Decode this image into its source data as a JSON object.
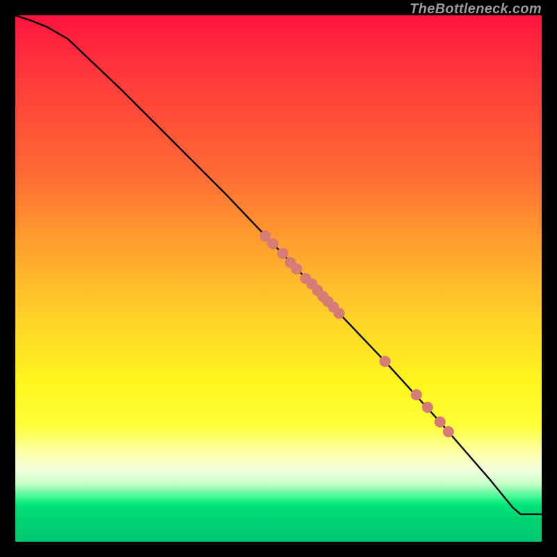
{
  "watermark": "TheBottleneck.com",
  "chart_data": {
    "type": "line",
    "title": "",
    "xlabel": "",
    "ylabel": "",
    "xlim": [
      0,
      100
    ],
    "ylim": [
      0,
      100
    ],
    "grid": false,
    "legend": false,
    "gradient_colors": {
      "top": "#ff143f",
      "mid_upper": "#ff9a2e",
      "mid": "#fff61e",
      "pale": "#fbffb0",
      "green": "#00d173"
    },
    "curve": {
      "x": [
        0,
        3,
        6,
        10,
        20,
        30,
        40,
        50,
        60,
        70,
        80,
        90,
        94.5,
        96,
        100
      ],
      "y": [
        100,
        99,
        97.8,
        95.5,
        86,
        76,
        66,
        55.5,
        45,
        34.5,
        23.5,
        12,
        6.5,
        5.2,
        5.2
      ]
    },
    "points": [
      {
        "x": 47.5,
        "y": 58.1
      },
      {
        "x": 48.9,
        "y": 56.6
      },
      {
        "x": 50.8,
        "y": 54.7
      },
      {
        "x": 52.3,
        "y": 53.1
      },
      {
        "x": 53.4,
        "y": 51.9
      },
      {
        "x": 55.2,
        "y": 50.0
      },
      {
        "x": 56.3,
        "y": 48.9
      },
      {
        "x": 57.4,
        "y": 47.7
      },
      {
        "x": 58.5,
        "y": 46.6
      },
      {
        "x": 59.4,
        "y": 45.6
      },
      {
        "x": 60.4,
        "y": 44.6
      },
      {
        "x": 61.5,
        "y": 43.4
      },
      {
        "x": 70.2,
        "y": 34.3
      },
      {
        "x": 76.2,
        "y": 27.9
      },
      {
        "x": 78.3,
        "y": 25.5
      },
      {
        "x": 80.7,
        "y": 22.8
      },
      {
        "x": 82.3,
        "y": 20.9
      }
    ]
  }
}
